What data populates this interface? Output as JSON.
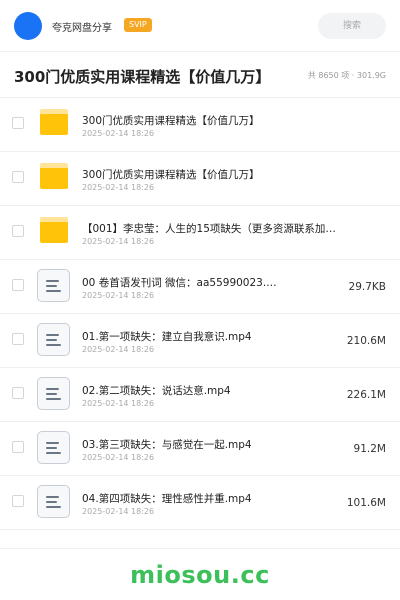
{
  "header": {
    "site_name": "夸克网盘分享",
    "badge": "SVIP",
    "search_placeholder": "搜索",
    "avatar_color": "#1a73f5"
  },
  "title_bar": {
    "title": "300门优质实用课程精选【价值几万】",
    "stats": "共 8650 项 · 301.9G"
  },
  "files": [
    {
      "type": "folder-icon",
      "name": "300门优质实用课程精选【价值几万】",
      "date": "2025-02-14 18:26",
      "size": ""
    },
    {
      "type": "folder-icon",
      "name": "300门优质实用课程精选【价值几万】",
      "date": "2025-02-14 18:26",
      "size": ""
    },
    {
      "type": "folder-icon",
      "name": "【001】李忠莹：人生的15项缺失（更多资源联系加…",
      "date": "2025-02-14 18:26",
      "size": ""
    },
    {
      "type": "file-icon",
      "name": "00 卷首语发刊词 微信：aa55990023.…",
      "date": "2025-02-14 18:26",
      "size": "29.7KB"
    },
    {
      "type": "file-icon",
      "name": "01.第一项缺失：建立自我意识.mp4",
      "date": "2025-02-14 18:26",
      "size": "210.6M"
    },
    {
      "type": "file-icon",
      "name": "02.第二项缺失：说话达意.mp4",
      "date": "2025-02-14 18:26",
      "size": "226.1M"
    },
    {
      "type": "file-icon",
      "name": "03.第三项缺失：与感觉在一起.mp4",
      "date": "2025-02-14 18:26",
      "size": "91.2M"
    },
    {
      "type": "file-icon",
      "name": "04.第四项缺失：理性感性并重.mp4",
      "date": "2025-02-14 18:26",
      "size": "101.6M"
    }
  ],
  "footer": {
    "watermark": "miosou.cc",
    "watermark_color": "#3cc05a"
  }
}
